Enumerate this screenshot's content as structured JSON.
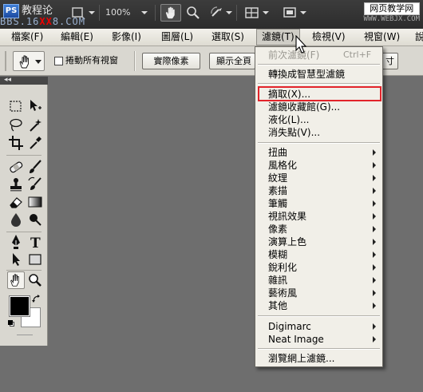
{
  "appbar": {
    "logo": "PS",
    "title": "教程论",
    "zoom": "100%",
    "watermark_site": "网页教学网",
    "watermark_site_en": "WWW.WEBJX.COM",
    "watermark_url_a": "BBS.16",
    "watermark_url_x": "XX",
    "watermark_url_b": "8.COM"
  },
  "menubar": {
    "items": [
      "檔案(F)",
      "編輯(E)",
      "影像(I)",
      "圖層(L)",
      "選取(S)",
      "濾鏡(T)",
      "檢視(V)",
      "視窗(W)",
      "說"
    ]
  },
  "options": {
    "scroll_all_label": "捲動所有視窗",
    "actual_pixels": "實際像素",
    "fit_screen": "顯示全頁",
    "print_size": "列印尺寸",
    "last_fragment": "寸"
  },
  "tools_panel": {
    "collapse_label": "◂◂"
  },
  "filter_menu": {
    "last_filter": "前次濾鏡(F)",
    "last_filter_shortcut": "Ctrl+F",
    "convert_smart": "轉換成智慧型濾鏡",
    "extract": "摘取(X)...",
    "filter_gallery": "濾鏡收藏館(G)...",
    "liquify": "液化(L)...",
    "vanishing_point": "消失點(V)...",
    "submenus": [
      "扭曲",
      "風格化",
      "紋理",
      "素描",
      "筆觸",
      "視訊效果",
      "像素",
      "演算上色",
      "模糊",
      "銳利化",
      "雜訊",
      "藝術風",
      "其他"
    ],
    "plugins": [
      "Digimarc",
      "Neat Image"
    ],
    "browse_online": "瀏覽網上濾鏡..."
  }
}
